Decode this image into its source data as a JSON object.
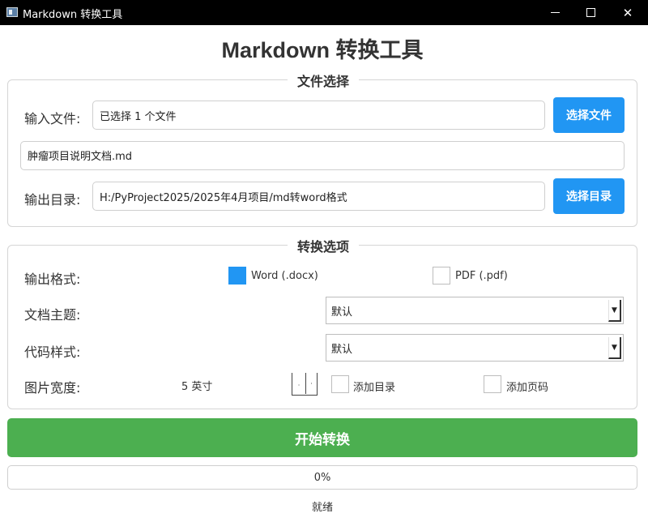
{
  "window": {
    "title": "Markdown 转换工具"
  },
  "header": {
    "title": "Markdown 转换工具"
  },
  "file_section": {
    "legend": "文件选择",
    "input_label": "输入文件:",
    "input_value": "已选择 1 个文件",
    "select_file_button": "选择文件",
    "file_list": [
      "肿瘤项目说明文档.md"
    ],
    "output_label": "输出目录:",
    "output_value": "H:/PyProject2025/2025年4月项目/md转word格式",
    "select_dir_button": "选择目录"
  },
  "options_section": {
    "legend": "转换选项",
    "format_label": "输出格式:",
    "format_word": {
      "label": "Word (.docx)",
      "checked": true
    },
    "format_pdf": {
      "label": "PDF (.pdf)",
      "checked": false
    },
    "theme_label": "文档主题:",
    "theme_value": "默认",
    "code_style_label": "代码样式:",
    "code_style_value": "默认",
    "image_width_label": "图片宽度:",
    "image_width_value": "5 英寸",
    "add_toc": {
      "label": "添加目录",
      "checked": false
    },
    "add_page_numbers": {
      "label": "添加页码",
      "checked": false
    }
  },
  "start_button": "开始转换",
  "progress": {
    "value": 0,
    "text": "0%"
  },
  "status": "就绪",
  "colors": {
    "accent_blue": "#2196f3",
    "start_green": "#4caf50",
    "titlebar": "#000000"
  }
}
